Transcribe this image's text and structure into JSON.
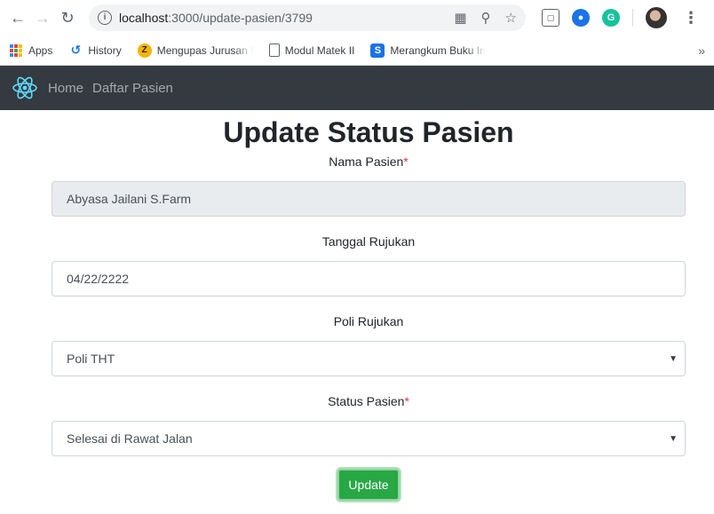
{
  "browser": {
    "url_host": "localhost",
    "url_path": ":3000/update-pasien/3799",
    "info_icon": "i",
    "bookmarks": {
      "apps": "Apps",
      "history": "History",
      "b1": "Mengupas Jurusan Ilı",
      "b2": "Modul Matek II",
      "b3": "Merangkum Buku Int",
      "more": "»"
    }
  },
  "navbar": {
    "home": "Home",
    "daftar": "Daftar Pasien"
  },
  "page": {
    "title": "Update Status Pasien",
    "nama_label": "Nama Pasien",
    "nama_value": "Abyasa Jailani S.Farm",
    "tanggal_label": "Tanggal Rujukan",
    "tanggal_value": "04/22/2222",
    "poli_label": "Poli Rujukan",
    "poli_value": "Poli THT",
    "status_label": "Status Pasien",
    "status_value": "Selesai di Rawat Jalan",
    "required_mark": "*",
    "submit_label": "Update"
  },
  "colors": {
    "navbar_bg": "#343a40",
    "button_bg": "#28a745",
    "required": "#dc3545",
    "readonly_bg": "#e9ecef"
  }
}
